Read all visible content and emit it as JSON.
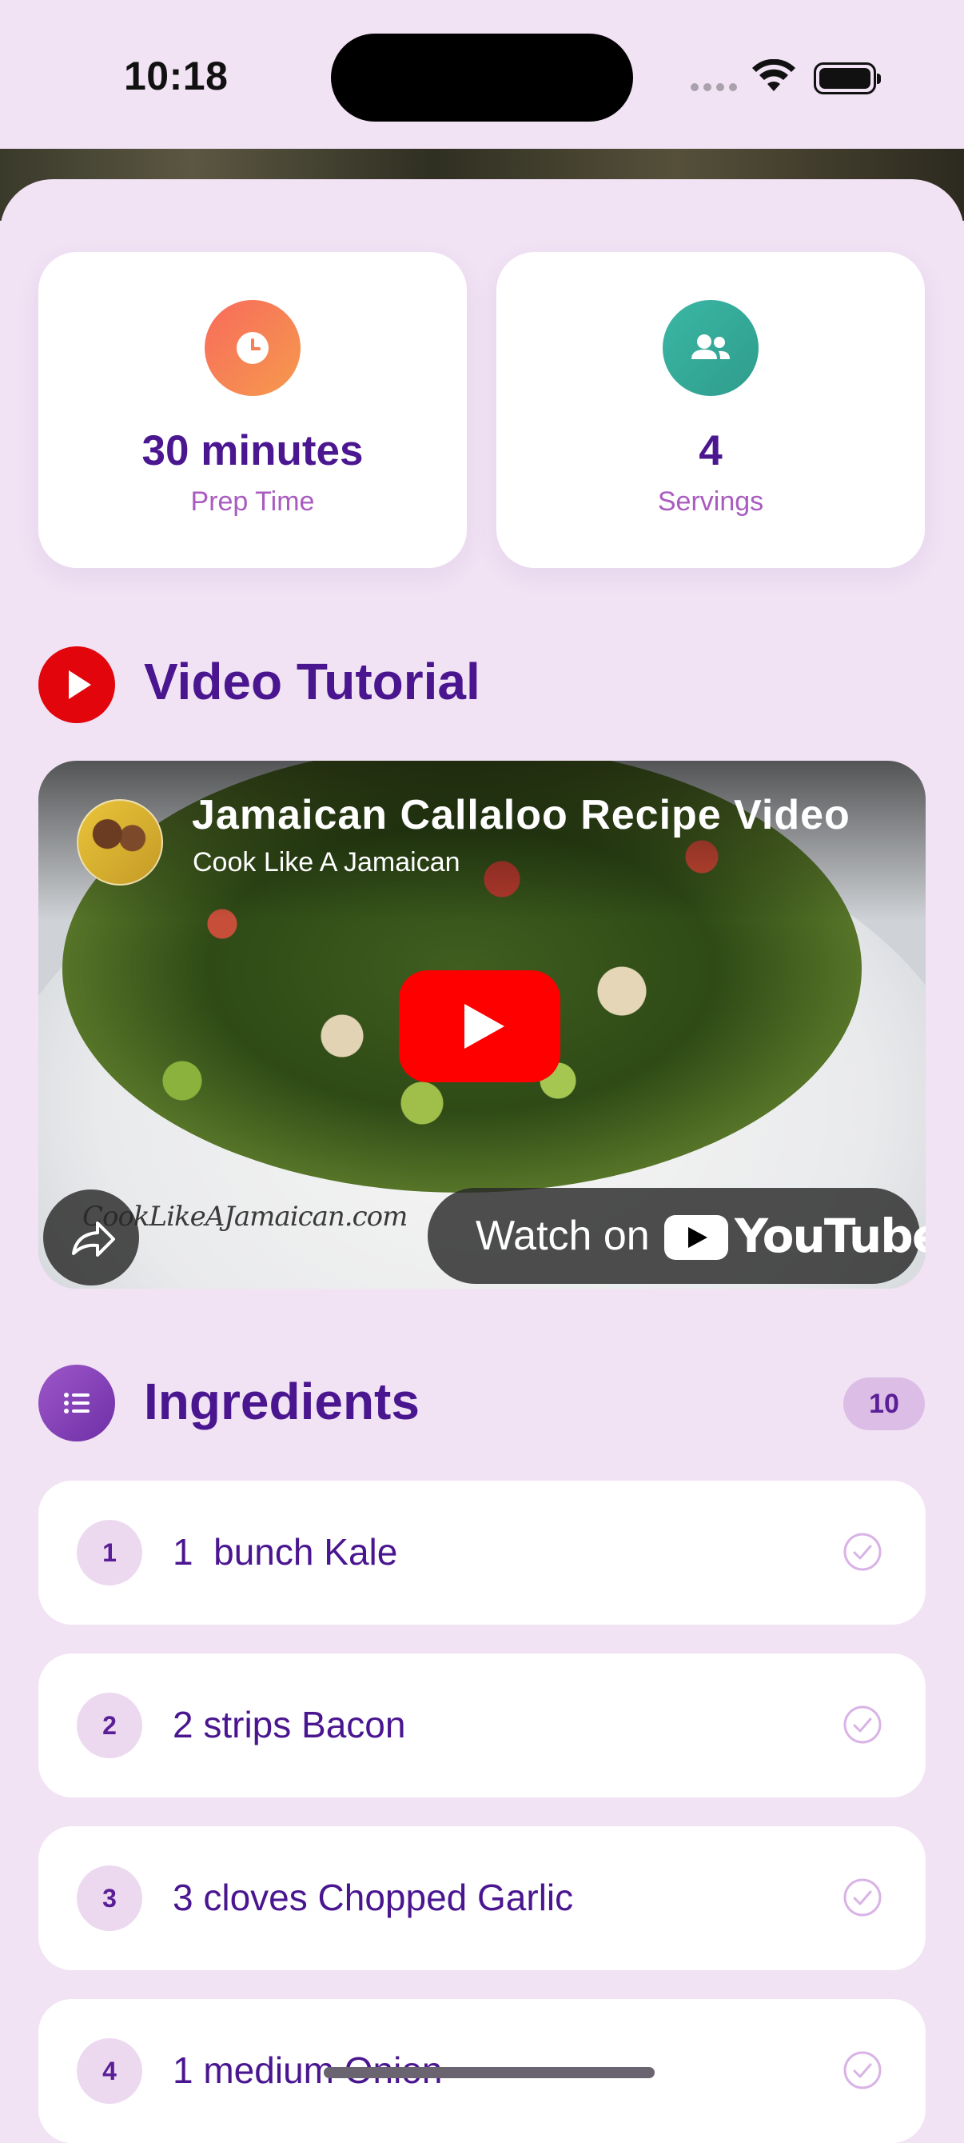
{
  "status_bar": {
    "time": "10:18"
  },
  "stats": {
    "prep_time": {
      "value": "30 minutes",
      "label": "Prep Time",
      "icon": "clock-icon"
    },
    "servings": {
      "value": "4",
      "label": "Servings",
      "icon": "people-icon"
    }
  },
  "video_section": {
    "title": "Video Tutorial",
    "video": {
      "title": "Jamaican Callaloo Recipe Video",
      "channel": "Cook Like A Jamaican",
      "watermark": "CookLikeAJamaican.com",
      "watch_on": "Watch on",
      "platform": "YouTube"
    }
  },
  "ingredients_section": {
    "title": "Ingredients",
    "count": "10",
    "items": [
      {
        "number": "1",
        "text": "1  bunch Kale"
      },
      {
        "number": "2",
        "text": "2 strips Bacon"
      },
      {
        "number": "3",
        "text": "3 cloves Chopped Garlic"
      },
      {
        "number": "4",
        "text": "1 medium Onion"
      }
    ]
  },
  "colors": {
    "background": "#f1e2f4",
    "accent_purple": "#4a1690",
    "youtube_red": "#ff0000",
    "prep_icon": "#f86b5c",
    "servings_icon": "#3bb7a5"
  }
}
